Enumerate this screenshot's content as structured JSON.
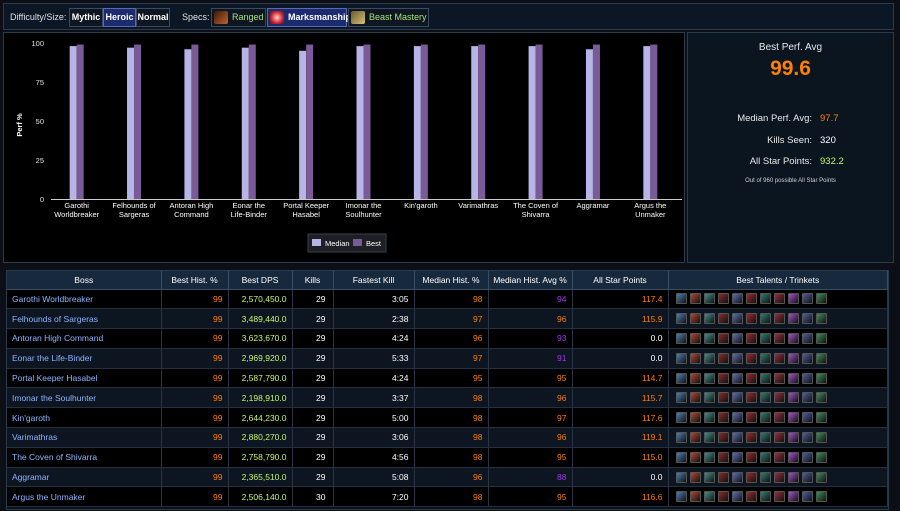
{
  "filters": {
    "difficulty_label": "Difficulty/Size:",
    "difficulties": [
      {
        "label": "Mythic",
        "active": false
      },
      {
        "label": "Heroic",
        "active": true
      },
      {
        "label": "Normal",
        "active": false
      }
    ],
    "specs_label": "Specs:",
    "specs": [
      {
        "label": "Ranged",
        "active": false,
        "icon": "ranged-icon"
      },
      {
        "label": "Marksmanship",
        "active": true,
        "icon": "marksmanship-icon"
      },
      {
        "label": "Beast Mastery",
        "active": false,
        "icon": "beast-mastery-icon"
      }
    ]
  },
  "chart_data": {
    "type": "bar",
    "ylabel": "Perf %",
    "ylim": [
      0,
      100
    ],
    "yticks": [
      0,
      25,
      50,
      75,
      100
    ],
    "categories": [
      "Garothi Worldbreaker",
      "Felhounds of Sargeras",
      "Antoran High Command",
      "Eonar the Life-Binder",
      "Portal Keeper Hasabel",
      "Imonar the Soulhunter",
      "Kin'garoth",
      "Varimathras",
      "The Coven of Shivarra",
      "Aggramar",
      "Argus the Unmaker"
    ],
    "series": [
      {
        "name": "Median",
        "color": "#b7b4e6",
        "values": [
          98,
          97,
          96,
          97,
          95,
          98,
          98,
          98,
          98,
          96,
          98
        ]
      },
      {
        "name": "Best",
        "color": "#7a5a97",
        "values": [
          99,
          99,
          99,
          99,
          99,
          99,
          99,
          99,
          99,
          99,
          99
        ]
      }
    ],
    "legend": "bottom-center"
  },
  "summary": {
    "title": "Best Perf. Avg",
    "best_value": "99.6",
    "median_label": "Median Perf. Avg:",
    "median_value": "97.7",
    "kills_label": "Kills Seen:",
    "kills_value": "320",
    "stars_label": "All Star Points:",
    "stars_value": "932.2",
    "note": "Out of 960 possible All Star Points"
  },
  "table": {
    "headers": [
      "Boss",
      "Best Hist. %",
      "Best DPS",
      "Kills",
      "Fastest Kill",
      "Median Hist. %",
      "Median Hist. Avg %",
      "All Star Points",
      "Best Talents / Trinkets"
    ],
    "rows": [
      {
        "boss": "Garothi Worldbreaker",
        "best": "99",
        "dps": "2,570,450.0",
        "kills": "29",
        "fastest": "3:05",
        "median": "98",
        "medavg": "94",
        "stars": "117.4"
      },
      {
        "boss": "Felhounds of Sargeras",
        "best": "99",
        "dps": "3,489,440.0",
        "kills": "29",
        "fastest": "2:38",
        "median": "97",
        "medavg": "96",
        "stars": "115.9"
      },
      {
        "boss": "Antoran High Command",
        "best": "99",
        "dps": "3,623,670.0",
        "kills": "29",
        "fastest": "4:24",
        "median": "96",
        "medavg": "93",
        "stars": "0.0"
      },
      {
        "boss": "Eonar the Life-Binder",
        "best": "99",
        "dps": "2,969,920.0",
        "kills": "29",
        "fastest": "5:33",
        "median": "97",
        "medavg": "91",
        "stars": "0.0"
      },
      {
        "boss": "Portal Keeper Hasabel",
        "best": "99",
        "dps": "2,587,790.0",
        "kills": "29",
        "fastest": "4:24",
        "median": "95",
        "medavg": "95",
        "stars": "114.7"
      },
      {
        "boss": "Imonar the Soulhunter",
        "best": "99",
        "dps": "2,198,910.0",
        "kills": "29",
        "fastest": "3:37",
        "median": "98",
        "medavg": "96",
        "stars": "115.7"
      },
      {
        "boss": "Kin'garoth",
        "best": "99",
        "dps": "2,644,230.0",
        "kills": "29",
        "fastest": "5:00",
        "median": "98",
        "medavg": "97",
        "stars": "117.6"
      },
      {
        "boss": "Varimathras",
        "best": "99",
        "dps": "2,880,270.0",
        "kills": "29",
        "fastest": "3:06",
        "median": "98",
        "medavg": "96",
        "stars": "119.1"
      },
      {
        "boss": "The Coven of Shivarra",
        "best": "99",
        "dps": "2,758,790.0",
        "kills": "29",
        "fastest": "4:56",
        "median": "98",
        "medavg": "95",
        "stars": "115.0"
      },
      {
        "boss": "Aggramar",
        "best": "99",
        "dps": "2,365,510.0",
        "kills": "29",
        "fastest": "5:08",
        "median": "96",
        "medavg": "88",
        "stars": "0.0"
      },
      {
        "boss": "Argus the Unmaker",
        "best": "99",
        "dps": "2,506,140.0",
        "kills": "30",
        "fastest": "7:20",
        "median": "98",
        "medavg": "95",
        "stars": "116.6"
      }
    ],
    "talent_icon_colors": [
      "#4a7fb5",
      "#b5462f",
      "#3f8e8a",
      "#8a2a2a",
      "#5d6fb8",
      "#a02828",
      "#2f7f70",
      "#9b2c3a",
      "#a94fd0",
      "#4d5fa0",
      "#3b8f55"
    ]
  }
}
